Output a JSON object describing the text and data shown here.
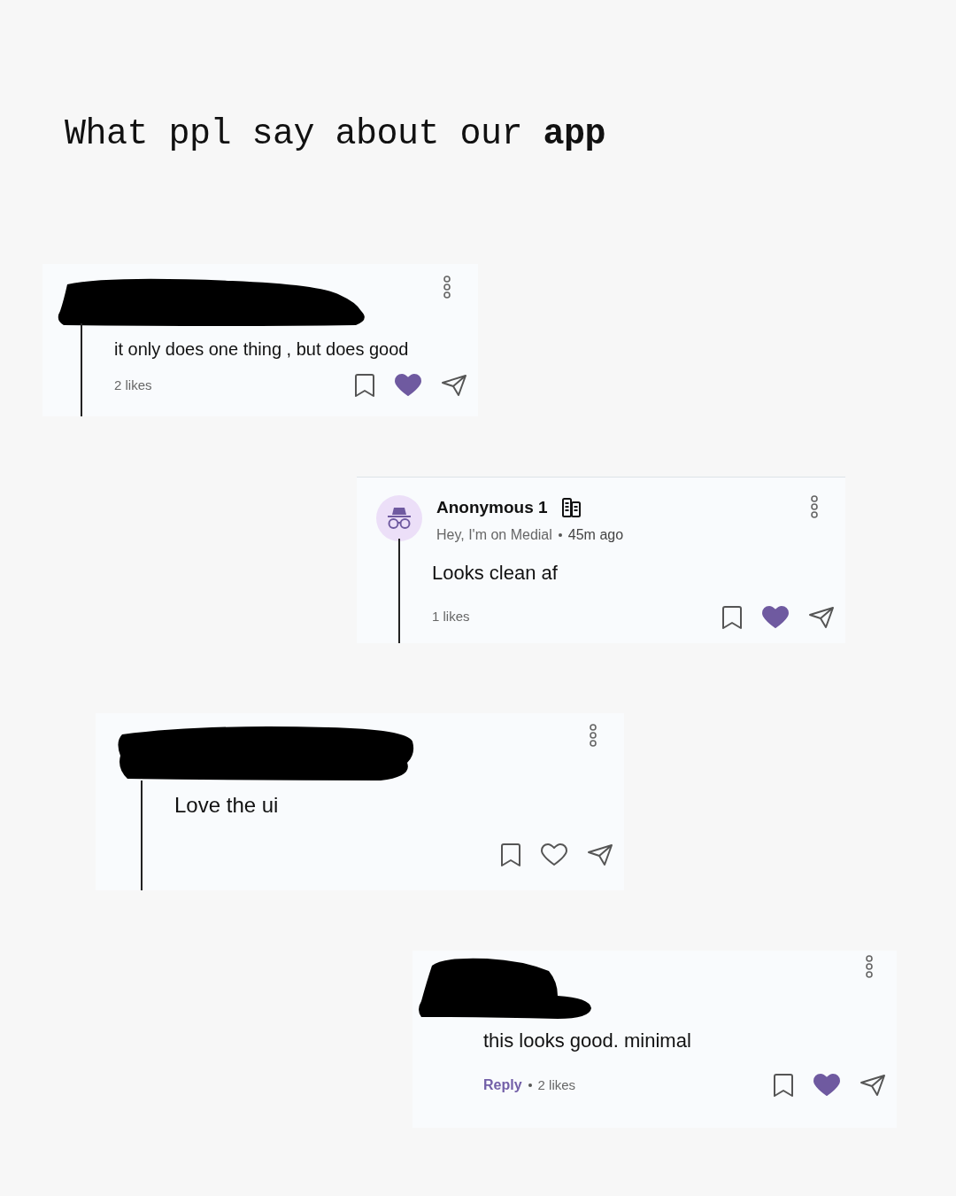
{
  "title": "What ppl say about our **app**",
  "comments": [
    {
      "redacted": true,
      "text": "it only does one thing , but does good",
      "likes": "2 likes",
      "bookmarked": false,
      "liked": true,
      "thread_line": true
    },
    {
      "redacted": false,
      "author": "Anonymous 1",
      "subtitle": "Hey, I'm on Medial",
      "time": "45m ago",
      "text": "Looks clean af",
      "likes": "1 likes",
      "bookmarked": false,
      "liked": true,
      "thread_line": true
    },
    {
      "redacted": true,
      "text": "Love the ui",
      "bookmarked": false,
      "liked": false,
      "thread_line": true
    },
    {
      "redacted": true,
      "text": "this looks good. minimal",
      "reply": "Reply",
      "likes": "2 likes",
      "bookmarked": false,
      "liked": true,
      "thread_line": false
    }
  ]
}
